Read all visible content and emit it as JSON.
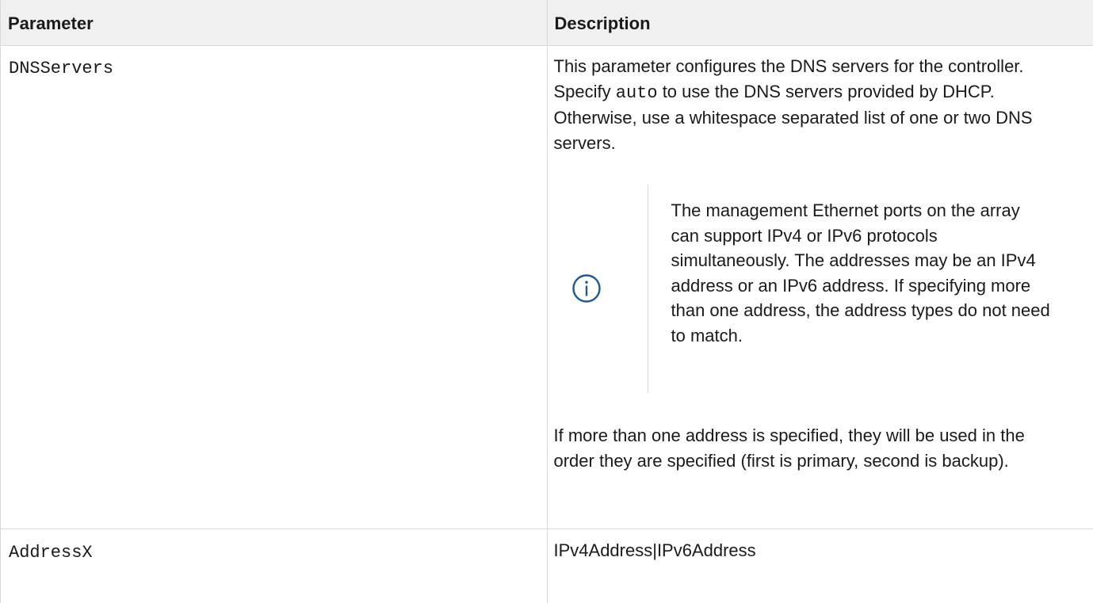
{
  "table": {
    "headers": {
      "parameter": "Parameter",
      "description": "Description"
    },
    "rows": [
      {
        "parameter": "DNSServers",
        "description": {
          "para1_before": "This parameter configures the DNS servers for the controller. Specify ",
          "para1_code": "auto",
          "para1_after": " to use the DNS servers provided by DHCP. Otherwise, use a whitespace separated list of one or two DNS servers.",
          "note_icon": "info-icon",
          "note": "The management Ethernet ports on the array can support IPv4 or IPv6 protocols simultaneously. The addresses may be an IPv4 address or an IPv6 address. If specifying more than one address, the address types do not need to match.",
          "para2": "If more than one address is specified, they will be used in the order they are specified (first is primary, second is backup)."
        }
      },
      {
        "parameter": "AddressX",
        "description": {
          "text": "IPv4Address|IPv6Address"
        }
      }
    ]
  },
  "colors": {
    "header_bg": "#f0f0f0",
    "border": "#d8d8d8",
    "note_icon": "#1a5a9a"
  }
}
